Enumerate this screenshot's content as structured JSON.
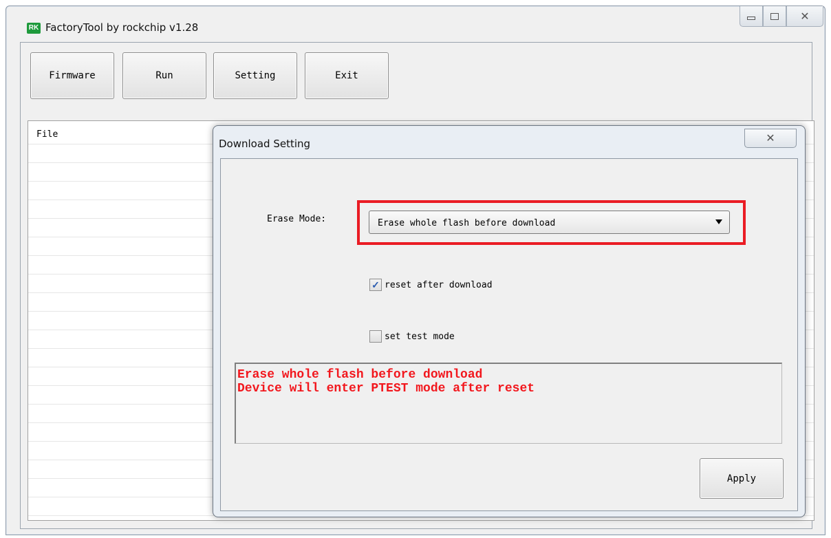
{
  "window": {
    "icon_text": "RK",
    "title": "FactoryTool by rockchip v1.28",
    "minimize_icon": "minimize-icon",
    "maximize_icon": "maximize-icon",
    "close_glyph": "✕"
  },
  "toolbar": {
    "firmware_label": "Firmware",
    "run_label": "Run",
    "setting_label": "Setting",
    "exit_label": "Exit"
  },
  "file_list": {
    "header": "File"
  },
  "dialog": {
    "title": "Download Setting",
    "close_glyph": "✕",
    "erase_mode_label": "Erase Mode:",
    "erase_mode_value": "Erase whole flash before download",
    "reset_checkbox": {
      "label": "reset after download",
      "checked": true
    },
    "test_mode_checkbox": {
      "label": "set test mode",
      "checked": false
    },
    "info_lines": [
      "Erase whole flash before download",
      "Device will enter PTEST mode after reset"
    ],
    "apply_label": "Apply"
  },
  "colors": {
    "highlight": "#ea1c24",
    "info_text": "#f2171d",
    "app_icon_bg": "#1e9a3c"
  }
}
